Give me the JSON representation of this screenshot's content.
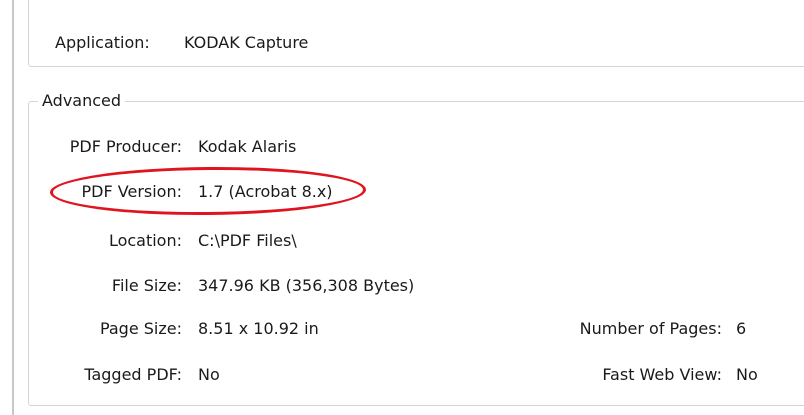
{
  "description": {
    "application_label": "Application:",
    "application_value": "KODAK Capture"
  },
  "advanced": {
    "legend": "Advanced",
    "pdf_producer_label": "PDF Producer:",
    "pdf_producer_value": "Kodak Alaris",
    "pdf_version_label": "PDF Version:",
    "pdf_version_value": "1.7 (Acrobat 8.x)",
    "location_label": "Location:",
    "location_value": "C:\\PDF Files\\",
    "file_size_label": "File Size:",
    "file_size_value": "347.96 KB (356,308 Bytes)",
    "page_size_label": "Page Size:",
    "page_size_value": "8.51 x 10.92 in",
    "num_pages_label": "Number of Pages:",
    "num_pages_value": "6",
    "tagged_pdf_label": "Tagged PDF:",
    "tagged_pdf_value": "No",
    "fast_web_view_label": "Fast Web View:",
    "fast_web_view_value": "No"
  },
  "annotation": {
    "highlight_color": "#e0141e"
  }
}
